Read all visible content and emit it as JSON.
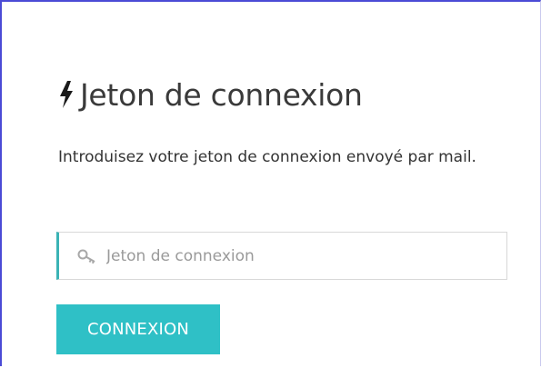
{
  "login_token": {
    "title": "Jeton de connexion",
    "title_icon": "bolt-icon",
    "description": "Introduisez votre jeton de connexion envoyé par mail.",
    "input": {
      "icon": "key-icon",
      "placeholder": "Jeton de connexion",
      "value": "",
      "accent_color": "#3ab3b5"
    },
    "submit_label": "CONNEXION",
    "submit_color": "#2fc0c6"
  }
}
